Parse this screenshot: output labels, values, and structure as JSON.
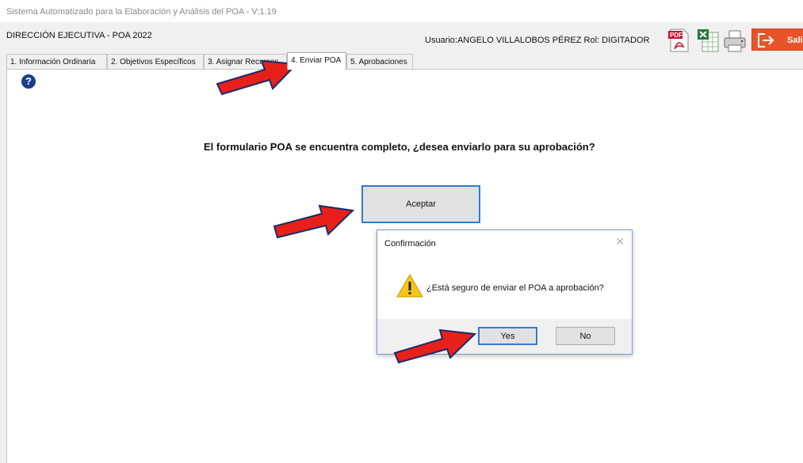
{
  "window": {
    "title": "Sistema Automatizado para la Elaboración y Análisis del POA -  V:1.19"
  },
  "header": {
    "section": "DIRECCIÓN EJECUTIVA - POA 2022",
    "user": "Usuario:ANGELO VILLALOBOS PÉREZ  Rol: DIGITADOR",
    "pdf_label": "PDF",
    "exit_label": "Sali"
  },
  "tabs": [
    {
      "label": "1. Información Ordinaria"
    },
    {
      "label": "2. Objetivos Específicos"
    },
    {
      "label": "3. Asignar Recursos"
    },
    {
      "label": "4. Enviar POA"
    },
    {
      "label": "5. Aprobaciones"
    }
  ],
  "main": {
    "help_glyph": "?",
    "question": "El formulario POA se encuentra completo, ¿desea enviarlo para su aprobación?",
    "accept_label": "Aceptar"
  },
  "dialog": {
    "title": "Confirmación",
    "close": "✕",
    "message": "¿Está seguro de enviar el POA a aprobación?",
    "yes_label": "Yes",
    "no_label": "No"
  },
  "colors": {
    "arrow": "#e8201a",
    "focus_border": "#2f7bd6",
    "exit_button": "#e8542a",
    "help_icon": "#1a3f8a",
    "warning": "#f5c518"
  }
}
